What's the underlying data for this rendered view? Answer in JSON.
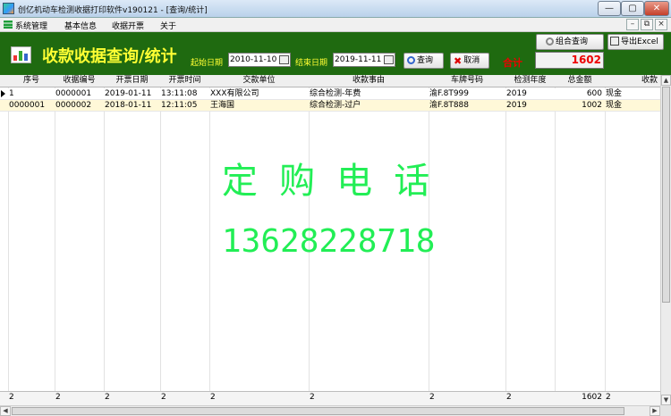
{
  "window": {
    "title": "创亿机动车检测收据打印软件v190121 - [查询/统计]"
  },
  "menu": {
    "items": [
      "系统管理",
      "基本信息",
      "收据开票",
      "关于"
    ]
  },
  "banner": {
    "title": "收款收据查询/统计",
    "start_label": "起始日期",
    "start_date": "2010-11-10",
    "end_label": "结束日期",
    "end_date": "2019-11-11",
    "query_button": "查询",
    "cancel_button": "取消",
    "combo_query_button": "组合查询",
    "export_button": "导出Excel",
    "total_label": "合计",
    "total_value": "1602"
  },
  "table": {
    "columns": [
      "序号",
      "收据编号",
      "开票日期",
      "开票时间",
      "交款单位",
      "收款事由",
      "车牌号码",
      "检测年度",
      "总金额",
      "收款"
    ],
    "rows": [
      [
        "1",
        "0000001",
        "2019-01-11",
        "13:11:08",
        "XXX有限公司",
        "综合检测-年费",
        "渝F.8T999",
        "2019",
        "600",
        "现金"
      ],
      [
        "0000001",
        "0000002",
        "2018-01-11",
        "12:11:05",
        "王海国",
        "综合检测-过户",
        "渝F.8T888",
        "2019",
        "1002",
        "现金"
      ]
    ],
    "footer": [
      "2",
      "2",
      "2",
      "2",
      "2",
      "2",
      "2",
      "2",
      "1602",
      "2"
    ]
  },
  "watermark": {
    "line1": "定 购 电 话",
    "line2": "13628228718"
  },
  "colors": {
    "banner_bg": "#1f6a10",
    "banner_text": "#ffff33",
    "total_text": "#ee0000",
    "watermark": "#22ee55",
    "alt_row": "#fff8d8"
  },
  "icons": {
    "app": "app-icon",
    "menu": "menu-icon",
    "query": "search-icon",
    "cancel": "cancel-icon",
    "combo": "magnifier-icon",
    "export": "export-icon",
    "chart": "chart-icon"
  }
}
